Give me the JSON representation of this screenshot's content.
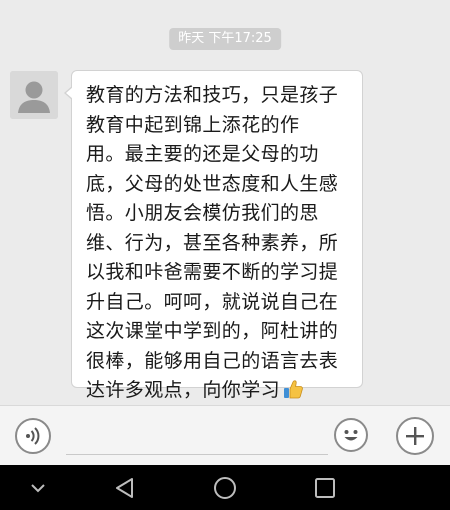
{
  "chat": {
    "timestamp": "昨天 下午17:25",
    "message": {
      "lines": [
        "教育的方法和技巧，只是孩子",
        "教育中起到锦上添花的作",
        "用。最主要的还是父母的功",
        "底，父母的处世态度和人生感",
        "悟。小朋友会模仿我们的思",
        "维、行为，甚至各种素养，所",
        "以我和咔爸需要不断的学习提",
        "升自己。呵呵，就说说自己在",
        "这次课堂中学到的，阿杜讲的",
        "很棒，能够用自己的语言去表",
        "达许多观点，向你学习"
      ],
      "trailing_emoji": "thumbs-up-icon"
    },
    "sender_avatar": "default-avatar-icon"
  },
  "input_bar": {
    "voice_icon": "voice-icon",
    "emoji_icon": "smiley-icon",
    "more_icon": "plus-icon",
    "text_value": ""
  },
  "nav_bar": {
    "icons": [
      "chevron-down-icon",
      "back-icon",
      "home-icon",
      "recents-icon"
    ]
  },
  "colors": {
    "chat_background": "#ebebeb",
    "bubble_background": "#ffffff",
    "timestamp_background": "#cecece",
    "nav_background": "#000000"
  }
}
